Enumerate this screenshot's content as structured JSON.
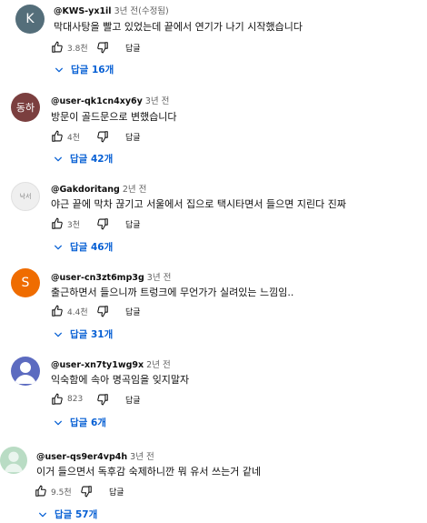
{
  "comments": [
    {
      "handle": "@KWS-yx1il",
      "time": "3년 전(수정됨)",
      "text": "막대사탕을 빨고 있었는데 끝에서 연기가 나기 시작했습니다",
      "likes": "3.8천",
      "reply": "답글",
      "replies": "답글 16개",
      "avatar_text": "K",
      "avatar_color": "#546e7a"
    },
    {
      "handle": "@user-qk1cn4xy6y",
      "time": "3년 전",
      "text": "방문이 골드문으로 변했습니다",
      "likes": "4천",
      "reply": "답글",
      "replies": "답글 42개",
      "avatar_text": "동하",
      "avatar_color": "#7b3f3f"
    },
    {
      "handle": "@Gakdoritang",
      "time": "2년 전",
      "text": "야근 끝에 막차 끊기고 서울에서 집으로 택시타면서 들으면 지린다 진짜",
      "likes": "3천",
      "reply": "답글",
      "replies": "답글 46개",
      "avatar_text": "낙서",
      "avatar_color": "#efefef"
    },
    {
      "handle": "@user-cn3zt6mp3g",
      "time": "3년 전",
      "text": "출근하면서 들으니까 트렁크에 무언가가 실려있는 느낌임..",
      "likes": "4.4천",
      "reply": "답글",
      "replies": "답글 31개",
      "avatar_text": "S",
      "avatar_color": "#ef6c00"
    },
    {
      "handle": "@user-xn7ty1wg9x",
      "time": "2년 전",
      "text": "익숙함에 속아 명곡임을 잊지말자",
      "likes": "823",
      "reply": "답글",
      "replies": "답글 6개",
      "avatar_text": "",
      "avatar_color": "#5c6bc0"
    },
    {
      "handle": "@user-qs9er4vp4h",
      "time": "3년 전",
      "text": "이거 들으면서 독후감 숙제하니깐 뭐 유서 쓰는거 같네",
      "likes": "9.5천",
      "reply": "답글",
      "replies": "답글 57개",
      "avatar_text": "",
      "avatar_color": "#b9dcc4"
    }
  ],
  "colors": {
    "link": "#065fd4",
    "secondary": "#606060"
  },
  "icons": {
    "like": "thumbs-up-icon",
    "dislike": "thumbs-down-icon",
    "expand": "chevron-down-icon"
  }
}
